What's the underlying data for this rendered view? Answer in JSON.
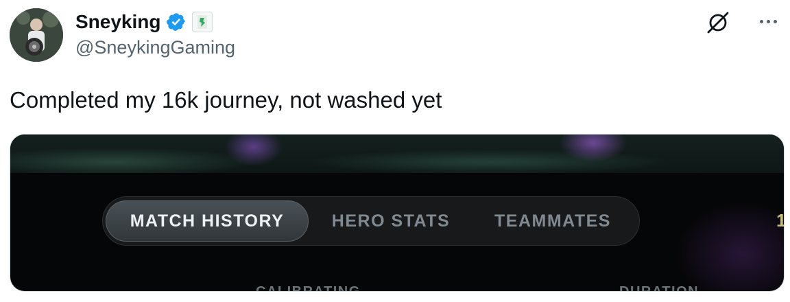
{
  "author": {
    "display_name": "Sneyking",
    "handle": "@SneykingGaming",
    "verified_icon": "verified-badge-icon",
    "affiliate_icon": "affiliate-badge-icon",
    "verified_color": "#1d9bf0"
  },
  "actions": {
    "grok_icon": "grok-icon",
    "more_icon": "more-options-icon"
  },
  "tweet": {
    "text": "Completed my 16k journey, not washed yet"
  },
  "media": {
    "tabs": [
      {
        "label": "MATCH HISTORY",
        "active": true
      },
      {
        "label": "HERO STATS",
        "active": false
      },
      {
        "label": "TEAMMATES",
        "active": false
      }
    ],
    "edge_fragment": "1",
    "cut_labels": [
      "CALIBRATING",
      "DURATION"
    ]
  },
  "colors": {
    "text_primary": "#0f1419",
    "text_secondary": "#536471",
    "media_bg": "#050607"
  }
}
